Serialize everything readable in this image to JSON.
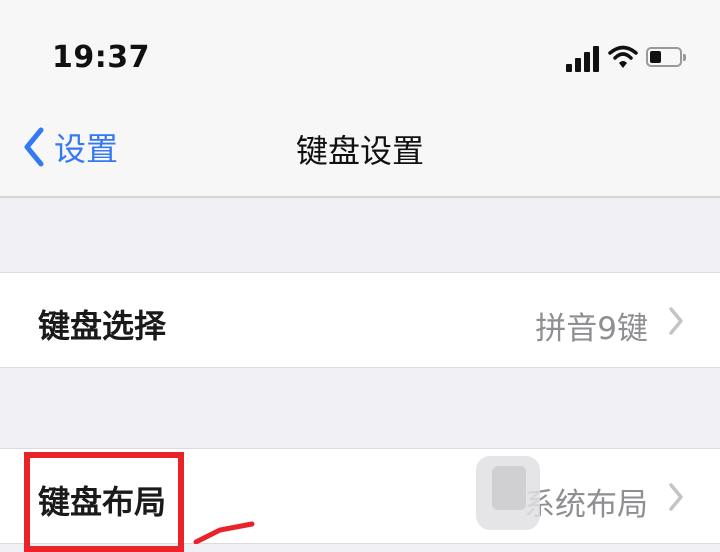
{
  "status_bar": {
    "time": "19:37",
    "icons": [
      "signal-icon",
      "wifi-icon",
      "battery-icon"
    ]
  },
  "nav": {
    "back_label": "设置",
    "title": "键盘设置",
    "accent_color": "#3478f6"
  },
  "rows": [
    {
      "label": "键盘选择",
      "value": "拼音9键"
    },
    {
      "label": "键盘布局",
      "value": "系统布局"
    }
  ],
  "annotation": {
    "highlight_color": "#e8232a"
  }
}
